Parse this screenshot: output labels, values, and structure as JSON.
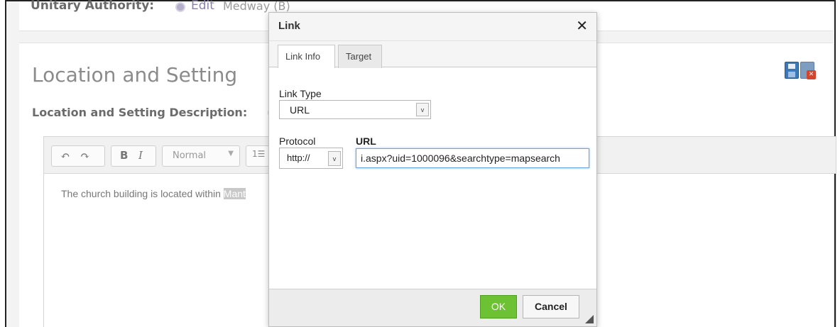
{
  "page": {
    "unitary_authority_label": "Unitary Authority:",
    "edit_label": "Edit",
    "unitary_authority_value": "Medway (B)",
    "section_title": "Location and Setting",
    "description_label": "Location and Setting Description:",
    "save_icon": "save-icon",
    "cancel_icon": "cancel-save-icon"
  },
  "editor": {
    "toolbar": {
      "undo_glyph": "↶",
      "redo_glyph": "↷",
      "bold": "B",
      "italic": "I",
      "format_value": "Normal",
      "format_arrow": "▼",
      "list_glyph": "1☰"
    },
    "content_text": "The church building is located within ",
    "content_highlight": "Mant"
  },
  "dialog": {
    "title": "Link",
    "close_glyph": "✕",
    "tabs": [
      {
        "label": "Link Info",
        "active": true
      },
      {
        "label": "Target",
        "active": false
      }
    ],
    "link_type_label": "Link Type",
    "link_type_value": "URL",
    "protocol_label": "Protocol",
    "protocol_value": "http://",
    "url_label": "URL",
    "url_value": "i.aspx?uid=1000096&searchtype=mapsearch",
    "dropdown_glyph": "v",
    "ok_label": "OK",
    "cancel_label": "Cancel"
  }
}
